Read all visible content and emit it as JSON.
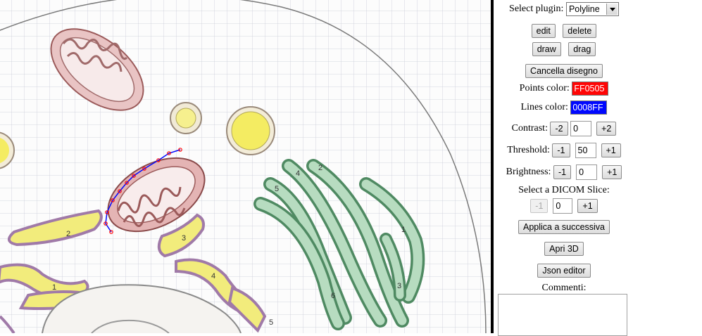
{
  "panel": {
    "select_plugin_label": "Select plugin:",
    "plugin_selected": "Polyline",
    "edit_label": "edit",
    "delete_label": "delete",
    "draw_label": "draw",
    "drag_label": "drag",
    "clear_label": "Cancella disegno",
    "points_color_label": "Points color:",
    "points_color_value": "FF0505",
    "lines_color_label": "Lines color:",
    "lines_color_value": "0008FF",
    "contrast_label": "Contrast:",
    "contrast_minus": "-2",
    "contrast_value": "0",
    "contrast_plus": "+2",
    "threshold_label": "Threshold:",
    "threshold_minus": "-1",
    "threshold_value": "50",
    "threshold_plus": "+1",
    "brightness_label": "Brightness:",
    "brightness_minus": "-1",
    "brightness_value": "0",
    "brightness_plus": "+1",
    "dicom_label": "Select a DICOM Slice:",
    "dicom_minus": "-1",
    "dicom_value": "0",
    "dicom_plus": "+1",
    "apply_next_label": "Applica a successiva",
    "open3d_label": "Apri 3D",
    "json_editor_label": "Json editor",
    "comments_label": "Commenti:",
    "comments_value": ""
  },
  "colors": {
    "points": "#FF0505",
    "lines": "#0008FF"
  },
  "canvas": {
    "organelle_numbers": [
      "2",
      "1",
      "3",
      "4",
      "5",
      "4",
      "2",
      "5",
      "1",
      "3",
      "6"
    ]
  }
}
